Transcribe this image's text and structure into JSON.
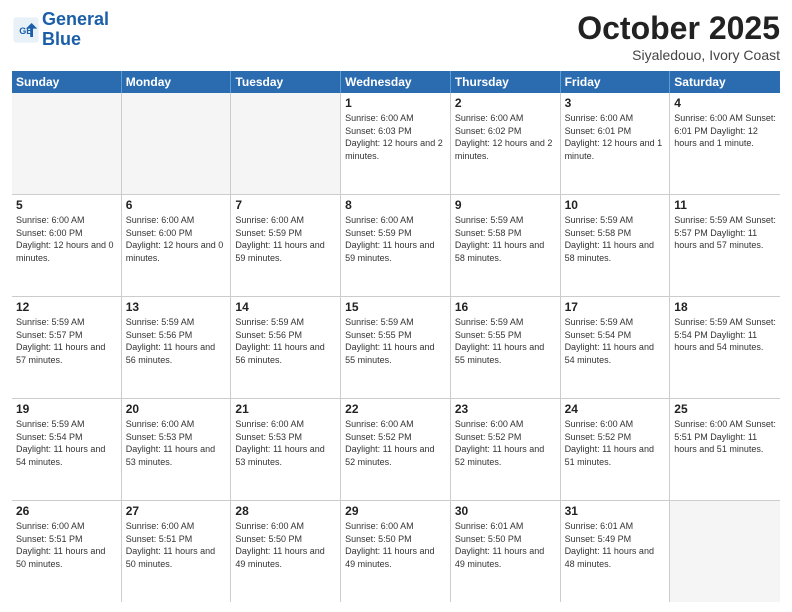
{
  "header": {
    "logo_line1": "General",
    "logo_line2": "Blue",
    "month": "October 2025",
    "location": "Siyaledouo, Ivory Coast"
  },
  "weekdays": [
    "Sunday",
    "Monday",
    "Tuesday",
    "Wednesday",
    "Thursday",
    "Friday",
    "Saturday"
  ],
  "weeks": [
    [
      {
        "day": "",
        "info": ""
      },
      {
        "day": "",
        "info": ""
      },
      {
        "day": "",
        "info": ""
      },
      {
        "day": "1",
        "info": "Sunrise: 6:00 AM\nSunset: 6:03 PM\nDaylight: 12 hours\nand 2 minutes."
      },
      {
        "day": "2",
        "info": "Sunrise: 6:00 AM\nSunset: 6:02 PM\nDaylight: 12 hours\nand 2 minutes."
      },
      {
        "day": "3",
        "info": "Sunrise: 6:00 AM\nSunset: 6:01 PM\nDaylight: 12 hours\nand 1 minute."
      },
      {
        "day": "4",
        "info": "Sunrise: 6:00 AM\nSunset: 6:01 PM\nDaylight: 12 hours\nand 1 minute."
      }
    ],
    [
      {
        "day": "5",
        "info": "Sunrise: 6:00 AM\nSunset: 6:00 PM\nDaylight: 12 hours\nand 0 minutes."
      },
      {
        "day": "6",
        "info": "Sunrise: 6:00 AM\nSunset: 6:00 PM\nDaylight: 12 hours\nand 0 minutes."
      },
      {
        "day": "7",
        "info": "Sunrise: 6:00 AM\nSunset: 5:59 PM\nDaylight: 11 hours\nand 59 minutes."
      },
      {
        "day": "8",
        "info": "Sunrise: 6:00 AM\nSunset: 5:59 PM\nDaylight: 11 hours\nand 59 minutes."
      },
      {
        "day": "9",
        "info": "Sunrise: 5:59 AM\nSunset: 5:58 PM\nDaylight: 11 hours\nand 58 minutes."
      },
      {
        "day": "10",
        "info": "Sunrise: 5:59 AM\nSunset: 5:58 PM\nDaylight: 11 hours\nand 58 minutes."
      },
      {
        "day": "11",
        "info": "Sunrise: 5:59 AM\nSunset: 5:57 PM\nDaylight: 11 hours\nand 57 minutes."
      }
    ],
    [
      {
        "day": "12",
        "info": "Sunrise: 5:59 AM\nSunset: 5:57 PM\nDaylight: 11 hours\nand 57 minutes."
      },
      {
        "day": "13",
        "info": "Sunrise: 5:59 AM\nSunset: 5:56 PM\nDaylight: 11 hours\nand 56 minutes."
      },
      {
        "day": "14",
        "info": "Sunrise: 5:59 AM\nSunset: 5:56 PM\nDaylight: 11 hours\nand 56 minutes."
      },
      {
        "day": "15",
        "info": "Sunrise: 5:59 AM\nSunset: 5:55 PM\nDaylight: 11 hours\nand 55 minutes."
      },
      {
        "day": "16",
        "info": "Sunrise: 5:59 AM\nSunset: 5:55 PM\nDaylight: 11 hours\nand 55 minutes."
      },
      {
        "day": "17",
        "info": "Sunrise: 5:59 AM\nSunset: 5:54 PM\nDaylight: 11 hours\nand 54 minutes."
      },
      {
        "day": "18",
        "info": "Sunrise: 5:59 AM\nSunset: 5:54 PM\nDaylight: 11 hours\nand 54 minutes."
      }
    ],
    [
      {
        "day": "19",
        "info": "Sunrise: 5:59 AM\nSunset: 5:54 PM\nDaylight: 11 hours\nand 54 minutes."
      },
      {
        "day": "20",
        "info": "Sunrise: 6:00 AM\nSunset: 5:53 PM\nDaylight: 11 hours\nand 53 minutes."
      },
      {
        "day": "21",
        "info": "Sunrise: 6:00 AM\nSunset: 5:53 PM\nDaylight: 11 hours\nand 53 minutes."
      },
      {
        "day": "22",
        "info": "Sunrise: 6:00 AM\nSunset: 5:52 PM\nDaylight: 11 hours\nand 52 minutes."
      },
      {
        "day": "23",
        "info": "Sunrise: 6:00 AM\nSunset: 5:52 PM\nDaylight: 11 hours\nand 52 minutes."
      },
      {
        "day": "24",
        "info": "Sunrise: 6:00 AM\nSunset: 5:52 PM\nDaylight: 11 hours\nand 51 minutes."
      },
      {
        "day": "25",
        "info": "Sunrise: 6:00 AM\nSunset: 5:51 PM\nDaylight: 11 hours\nand 51 minutes."
      }
    ],
    [
      {
        "day": "26",
        "info": "Sunrise: 6:00 AM\nSunset: 5:51 PM\nDaylight: 11 hours\nand 50 minutes."
      },
      {
        "day": "27",
        "info": "Sunrise: 6:00 AM\nSunset: 5:51 PM\nDaylight: 11 hours\nand 50 minutes."
      },
      {
        "day": "28",
        "info": "Sunrise: 6:00 AM\nSunset: 5:50 PM\nDaylight: 11 hours\nand 49 minutes."
      },
      {
        "day": "29",
        "info": "Sunrise: 6:00 AM\nSunset: 5:50 PM\nDaylight: 11 hours\nand 49 minutes."
      },
      {
        "day": "30",
        "info": "Sunrise: 6:01 AM\nSunset: 5:50 PM\nDaylight: 11 hours\nand 49 minutes."
      },
      {
        "day": "31",
        "info": "Sunrise: 6:01 AM\nSunset: 5:49 PM\nDaylight: 11 hours\nand 48 minutes."
      },
      {
        "day": "",
        "info": ""
      }
    ]
  ]
}
